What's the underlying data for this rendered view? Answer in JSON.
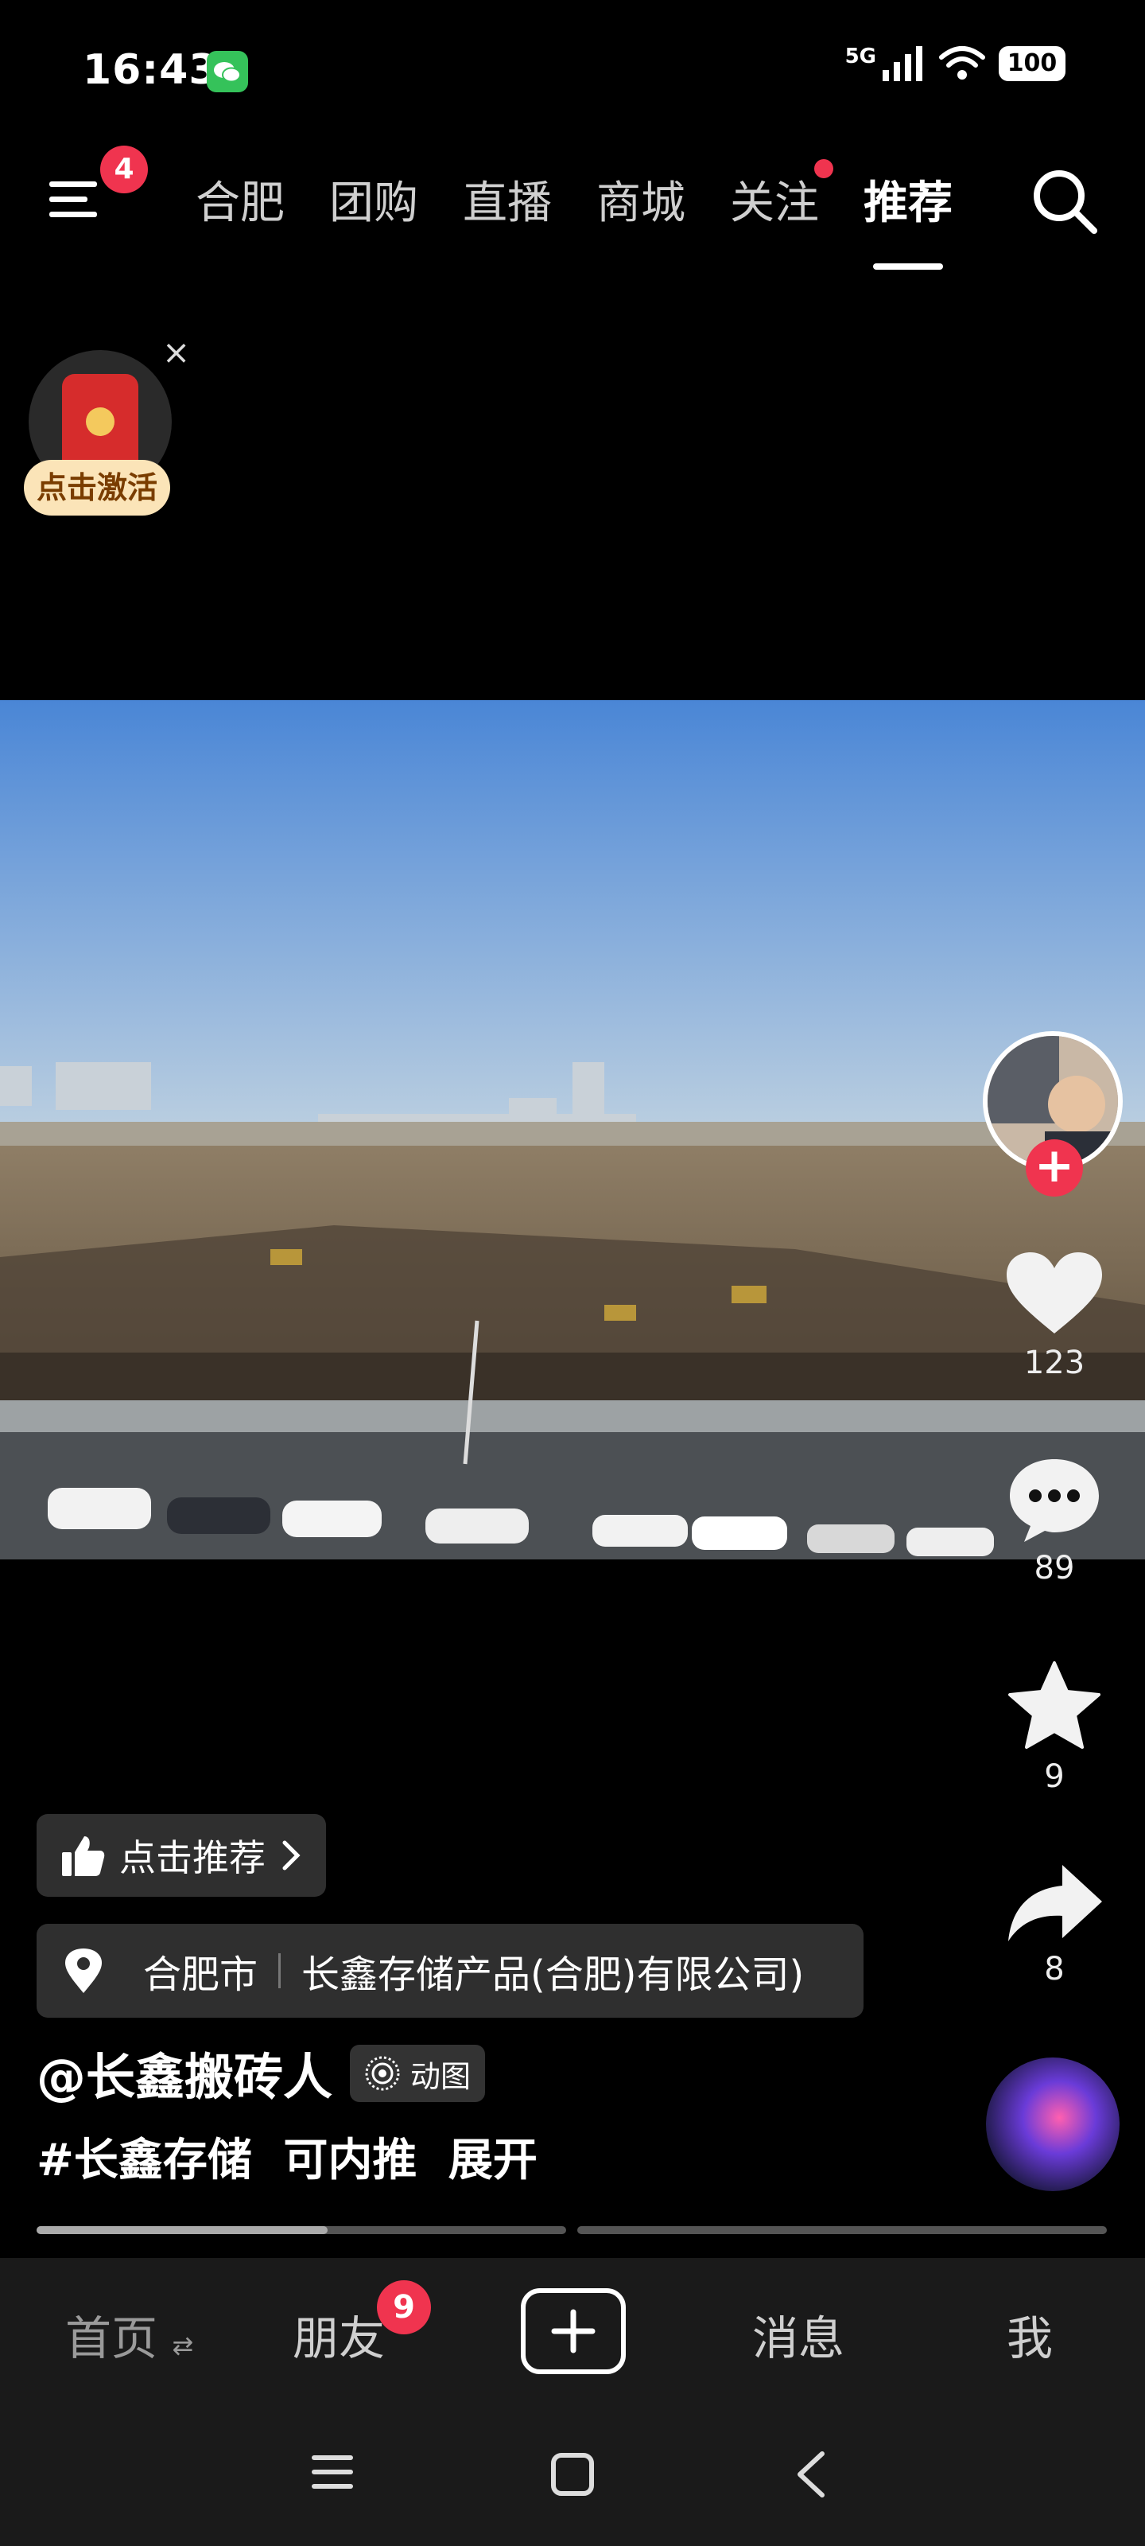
{
  "status_bar": {
    "time": "16:43",
    "network": "5G",
    "battery": "100"
  },
  "top_nav": {
    "menu_badge": "4",
    "tabs": [
      "合肥",
      "团购",
      "直播",
      "商城",
      "关注",
      "推荐"
    ],
    "active_tab": "推荐"
  },
  "red_packet": {
    "label": "点击激活",
    "close": "×"
  },
  "actions": {
    "like_count": "123",
    "comment_count": "89",
    "favorite_count": "9",
    "share_count": "8"
  },
  "info": {
    "recommend": "点击推荐",
    "location_city": "合肥市",
    "location_place": "长鑫存储产品(合肥)有限公司)",
    "author": "@长鑫搬砖人",
    "motion_badge": "动图",
    "caption_tag": "#长鑫存储",
    "caption_text": "可内推",
    "expand": "展开",
    "progress_segments": [
      0.55,
      0.0
    ]
  },
  "bottom_tabs": {
    "home": "首页",
    "friends": "朋友",
    "friends_badge": "9",
    "messages": "消息",
    "me": "我"
  },
  "colors": {
    "accent_red": "#f0344f",
    "chip_bg": "#2f2f2f"
  }
}
